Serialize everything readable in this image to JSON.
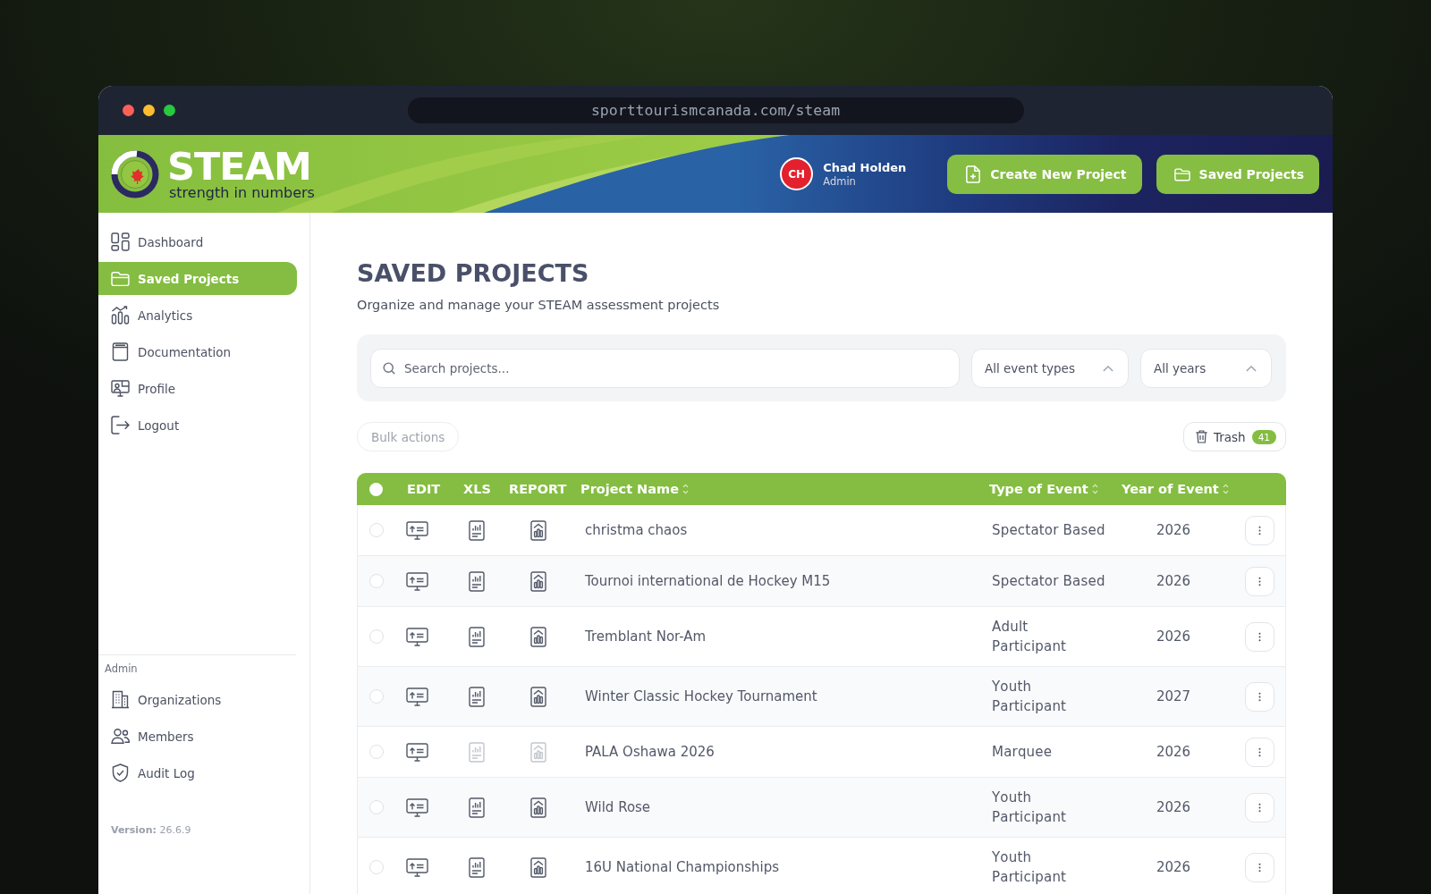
{
  "browser": {
    "url": "sporttourismcanada.com/steam"
  },
  "header": {
    "logo": {
      "title": "STEAM",
      "tagline": "strength in numbers"
    },
    "user": {
      "initials": "CH",
      "name": "Chad Holden",
      "role": "Admin"
    },
    "buttons": [
      {
        "label": "Create New Project"
      },
      {
        "label": "Saved Projects"
      }
    ]
  },
  "sidebar": {
    "items": [
      {
        "label": "Dashboard",
        "selected": false
      },
      {
        "label": "Saved Projects",
        "selected": true
      },
      {
        "label": "Analytics",
        "selected": false
      },
      {
        "label": "Documentation",
        "selected": false
      },
      {
        "label": "Profile",
        "selected": false
      },
      {
        "label": "Logout",
        "selected": false
      }
    ],
    "admin": {
      "title": "Admin",
      "items": [
        {
          "label": "Organizations",
          "selected": false
        },
        {
          "label": "Members",
          "selected": false
        },
        {
          "label": "Audit Log",
          "selected": false
        }
      ]
    },
    "version": "**Version:** 26.6.9"
  },
  "page": {
    "title": "SAVED PROJECTS",
    "subtitle": "Organize and manage your STEAM assessment projects"
  },
  "filters": {
    "search": {
      "placeholder": "Search projects..."
    },
    "dropdowns": [
      {
        "value": "All event types"
      },
      {
        "value": "All years"
      }
    ]
  },
  "toolbar": {
    "bulk_actions": {
      "label": "Bulk actions",
      "disabled": true
    },
    "trash": {
      "label": "Trash",
      "count": "41"
    }
  },
  "table": {
    "select_all": {
      "checked": false
    },
    "columns": [
      {
        "label": "EDIT",
        "sortable": false
      },
      {
        "label": "XLS",
        "sortable": false
      },
      {
        "label": "REPORT",
        "sortable": false
      },
      {
        "label": "Project Name",
        "sortable": true
      },
      {
        "label": "Type of Event",
        "sortable": true
      },
      {
        "label": "Year of Event",
        "sortable": true
      }
    ],
    "rows": [
      {
        "selected": false,
        "name": "christma chaos",
        "type": "Spectator Based",
        "year": "2026",
        "xls_disabled": false,
        "report_disabled": false
      },
      {
        "selected": false,
        "name": "Tournoi international de Hockey M15",
        "type": "Spectator Based",
        "year": "2026",
        "xls_disabled": false,
        "report_disabled": false
      },
      {
        "selected": false,
        "name": "Tremblant Nor-Am",
        "type": "Adult Participant",
        "year": "2026",
        "xls_disabled": false,
        "report_disabled": false
      },
      {
        "selected": false,
        "name": "Winter Classic Hockey Tournament",
        "type": "Youth Participant",
        "year": "2027",
        "xls_disabled": false,
        "report_disabled": false
      },
      {
        "selected": false,
        "name": "PALA Oshawa 2026",
        "type": "Marquee",
        "year": "2026",
        "xls_disabled": true,
        "report_disabled": true
      },
      {
        "selected": false,
        "name": "Wild Rose",
        "type": "Youth Participant",
        "year": "2026",
        "xls_disabled": false,
        "report_disabled": false
      },
      {
        "selected": false,
        "name": "16U National Championships",
        "type": "Youth Participant",
        "year": "2026",
        "xls_disabled": false,
        "report_disabled": false
      }
    ]
  }
}
